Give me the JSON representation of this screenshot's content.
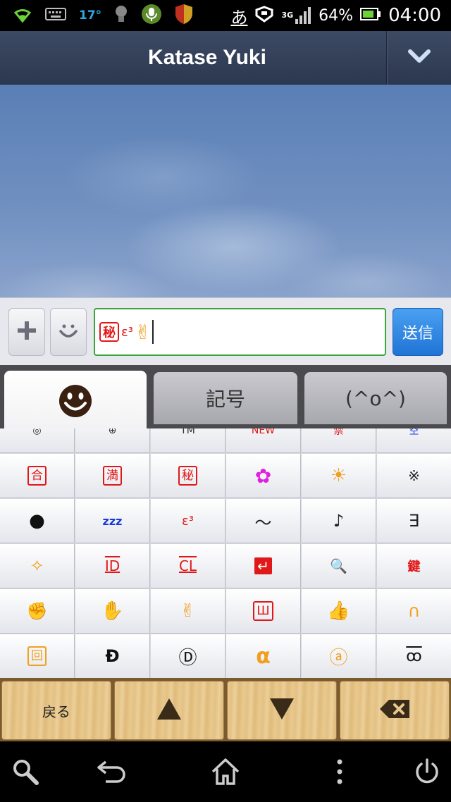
{
  "status_bar": {
    "temperature": "17°",
    "ime_indicator": "あ",
    "network": "3G",
    "battery": "64%",
    "time": "04:00"
  },
  "header": {
    "title": "Katase Yuki",
    "dropdown_icon": "chevron-down-icon"
  },
  "input_bar": {
    "plus_icon": "plus-icon",
    "smiley_icon": "smiley-icon",
    "text_seal": "秘",
    "text_sigma": "ε³",
    "text_peace": "✌",
    "send_label": "送信"
  },
  "tabs": [
    {
      "label": "",
      "icon": "smiley-face-icon",
      "active": true
    },
    {
      "label": "記号",
      "active": false
    },
    {
      "label": "(^o^)",
      "active": false
    }
  ],
  "emoji_grid": {
    "partial_row": [
      "◎",
      "⊕",
      "TM",
      "NEW",
      "禁",
      "空"
    ],
    "rows": [
      [
        "合",
        "満",
        "秘",
        "✿",
        "☀",
        "※"
      ],
      [
        "●",
        "zzz",
        "ε³",
        "〜",
        "♪",
        "∃"
      ],
      [
        "✧",
        "ID",
        "CL",
        "↵",
        "🔍",
        "鍵"
      ],
      [
        "✊",
        "✋",
        "✌",
        "Ш",
        "👍",
        "∩"
      ],
      [
        "回",
        "Đ",
        "Ⓓ",
        "α",
        "ⓐ",
        "ꝏ"
      ]
    ]
  },
  "bottom_keys": {
    "back_label": "戻る",
    "up_icon": "triangle-up-icon",
    "down_icon": "triangle-down-icon",
    "delete_icon": "backspace-icon"
  },
  "nav_bar": {
    "icons": [
      "search-icon",
      "back-icon",
      "home-icon",
      "menu-icon",
      "power-icon"
    ]
  },
  "colors": {
    "header_bg": "#34405a",
    "input_border": "#3aa63a",
    "send_blue": "#2a84e0",
    "seal_red": "#e01818",
    "emoji_orange": "#f0a020",
    "emoji_magenta": "#e020e0",
    "emoji_blue": "#1a3ad8"
  }
}
